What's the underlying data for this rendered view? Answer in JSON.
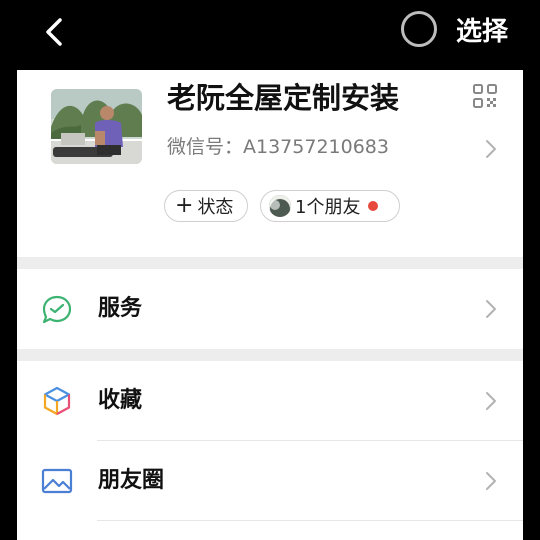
{
  "topbar": {
    "select_label": "选择"
  },
  "profile": {
    "name": "老阮全屋定制安装",
    "wechat_id": "微信号：A13757210683",
    "status_plus": "+",
    "status_label": "状态",
    "friends_label": "1个朋友"
  },
  "menu": [
    {
      "label": "服务",
      "icon": "services-icon"
    },
    {
      "label": "收藏",
      "icon": "favorites-icon"
    },
    {
      "label": "朋友圈",
      "icon": "moments-icon"
    }
  ],
  "colors": {
    "background": "#000000",
    "sheet": "#ffffff",
    "section_gap": "#ededed",
    "accent_green": "#07c160",
    "notification_red": "#e8493d"
  }
}
